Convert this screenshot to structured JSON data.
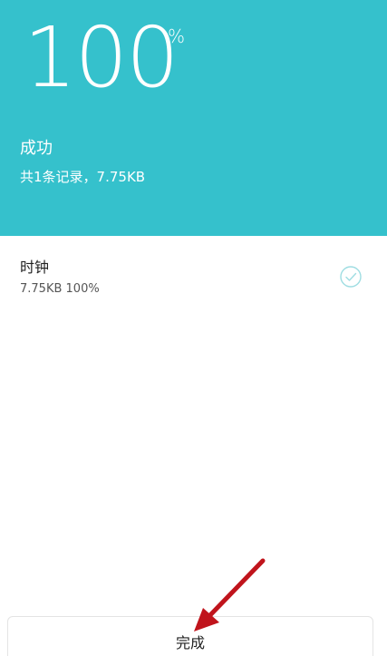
{
  "header": {
    "progress_number": "100",
    "progress_unit": "%",
    "progress_value": 100,
    "status": "成功",
    "summary": "共1条记录，7.75KB",
    "background_color": "#35c1cc"
  },
  "items": [
    {
      "name": "时钟",
      "detail": "7.75KB 100%",
      "status_icon": "check-circle-icon"
    }
  ],
  "footer": {
    "done_label": "完成"
  },
  "annotation": {
    "arrow_color": "#c0141c",
    "arrow_icon": "red-arrow"
  }
}
